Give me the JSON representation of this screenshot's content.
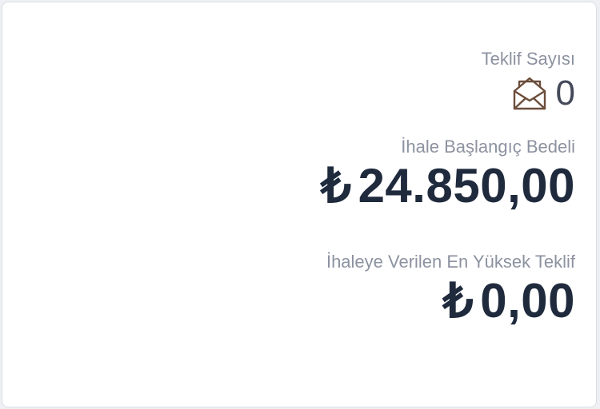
{
  "offers": {
    "label": "Teklif Sayısı",
    "icon": "open-envelope-icon",
    "count": "0"
  },
  "starting_price": {
    "label": "İhale Başlangıç Bedeli",
    "currency_symbol": "₺",
    "amount": "24.850,00"
  },
  "highest_bid": {
    "label": "İhaleye Verilen En Yüksek Teklif",
    "currency_symbol": "₺",
    "amount": "0,00"
  },
  "colors": {
    "label_gray": "#8c92a0",
    "amount_navy": "#1f2a3d",
    "icon_brown": "#6b4d3b"
  }
}
